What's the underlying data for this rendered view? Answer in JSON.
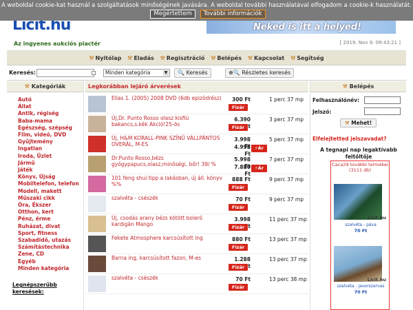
{
  "cookie": {
    "text": "A weboldal cookie-kat használ a szolgáltatások minőségének javására. A weboldal további használatával elfogadom a cookie-k használatát.",
    "accept": "Megértettem",
    "more": "További információk"
  },
  "header": {
    "logo_main": "Licit",
    "logo_tld": ".hu",
    "tagline": "Az ingyenes aukciós piactér",
    "banner": "Neked is itt a helyed!",
    "datetime": "[ 2019. Nov 9. 09:43:21 ]"
  },
  "nav": [
    "Nyitólap",
    "Eladás",
    "Regisztráció",
    "Belépés",
    "Kapcsolat",
    "Segítség"
  ],
  "search": {
    "label": "Keresés:",
    "category": "Minden kategória",
    "button": "Keresés",
    "advanced": "Részletes keresés"
  },
  "categories": {
    "heading": "Kategóriák",
    "items": [
      "Autó",
      "Állat",
      "Antik, régiség",
      "Baba-mama",
      "Egészség, szépség",
      "Film, videó, DVD",
      "Gyűjtemény",
      "Ingatlan",
      "Iroda, Üzlet",
      "Jármű",
      "Játék",
      "Könyv, Újság",
      "Mobiltelefon, telefon",
      "Modell, makett",
      "Műszaki cikk",
      "Óra, Ékszer",
      "Otthon, kert",
      "Pénz, érme",
      "Ruházat, divat",
      "Sport, fitness",
      "Szabadidő, utazás",
      "Számítástechnika",
      "Zene, CD",
      "Egyéb",
      "Minden kategória"
    ],
    "popular": "Legnépszerűbb keresések:"
  },
  "listing": {
    "heading": "Legkorábban lejáró árverések",
    "bid_label": "Fizár",
    "buy_label": "Ár",
    "rows": [
      {
        "title": "Elias 1. (2005) 2008 DVD (6db epizódrész)",
        "price": "300 Ft",
        "price2": "",
        "time": "1 perc 37 mp",
        "buy": false
      },
      {
        "title": "Új,Dr. Punto Rosso olasz kisfiú bakancs,s.kék Akció!25-ös",
        "price": "6.390 Ft",
        "price2": "",
        "time": "3 perc 37 mp",
        "buy": false
      },
      {
        "title": "Új, H&M KORALL-PINK SZÍNŰ VÁLLPÁNTOS OVERÁL, M-ES",
        "price": "3.998 Ft",
        "price2": "4.998 Ft",
        "time": "5 perc 37 mp",
        "buy": true
      },
      {
        "title": "Dr.Punto Rosso,bézs gyógypapucs,olasz,minőségi, bőr! 39/ %",
        "price": "5.998 Ft",
        "price2": "7.880 Ft",
        "time": "7 perc 37 mp",
        "buy": true
      },
      {
        "title": "101 feng shui tipp a lakásban, új áll. könyv %%",
        "price": "888 Ft",
        "price2": "",
        "time": "9 perc 37 mp",
        "buy": false
      },
      {
        "title": "szalvéta - csészék",
        "price": "70 Ft",
        "price2": "",
        "time": "9 perc 37 mp",
        "buy": false
      },
      {
        "title": "Új, csodás arany bézs kötött boleró kardigán Mango",
        "price": "3.998 Ft",
        "price2": "",
        "time": "11 perc 37 mp",
        "buy": false
      },
      {
        "title": "Fekete Atmosphere karcsúsított ing",
        "price": "880 Ft",
        "price2": "",
        "time": "13 perc 37 mp",
        "buy": false
      },
      {
        "title": "Barna ing, karcsúsított fazon, M-es",
        "price": "1.288 Ft",
        "price2": "",
        "time": "13 perc 37 mp",
        "buy": false
      },
      {
        "title": "szalvéta - csészék",
        "price": "70 Ft",
        "price2": "",
        "time": "13 perc 38 mp",
        "buy": false
      }
    ]
  },
  "login": {
    "heading": "Belépés",
    "username": "Felhasználónév:",
    "password": "Jelszó:",
    "submit": "Mehet!",
    "forgot": "Elfelejtetted jelszavadat?"
  },
  "hot": {
    "title": "A tegnapi nap legaktívabb feltöltője",
    "link": "Caca29 további termékei (3111 db)",
    "watermark": "Licit.hu",
    "items": [
      {
        "caption": "szalvéta - páva",
        "price": "70 Ft"
      },
      {
        "caption": "szalvéta - javorszarvas",
        "price": "70 Ft"
      }
    ]
  },
  "colors": {
    "accent": "#c1272d",
    "brand": "#1a4fb0",
    "nav_bg": "#e8e4d4"
  }
}
